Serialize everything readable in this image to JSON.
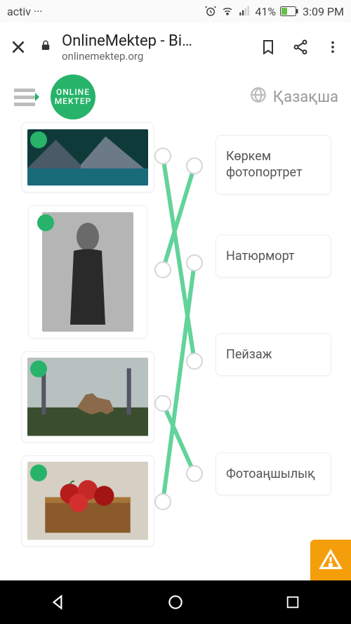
{
  "statusbar": {
    "carrier": "activ",
    "battery_pct": "41%",
    "time": "3:09 PM"
  },
  "browser": {
    "title": "OnlineMektep - Bi…",
    "domain": "onlinemektep.org"
  },
  "app": {
    "logo_line1": "ONLINE",
    "logo_line2": "MEKTEP",
    "language": "Қазақша"
  },
  "exercise": {
    "left_items": [
      {
        "id": "img-landscape",
        "alt": "mountain-lake"
      },
      {
        "id": "img-portrait",
        "alt": "woman-bw-portrait"
      },
      {
        "id": "img-wildlife",
        "alt": "wolf-forest"
      },
      {
        "id": "img-stilllife",
        "alt": "apples-crate"
      }
    ],
    "right_items": [
      {
        "label": "Көркем фотопортрет"
      },
      {
        "label": "Натюрморт"
      },
      {
        "label": "Пейзаж"
      },
      {
        "label": "Фотоаңшылық"
      }
    ]
  }
}
